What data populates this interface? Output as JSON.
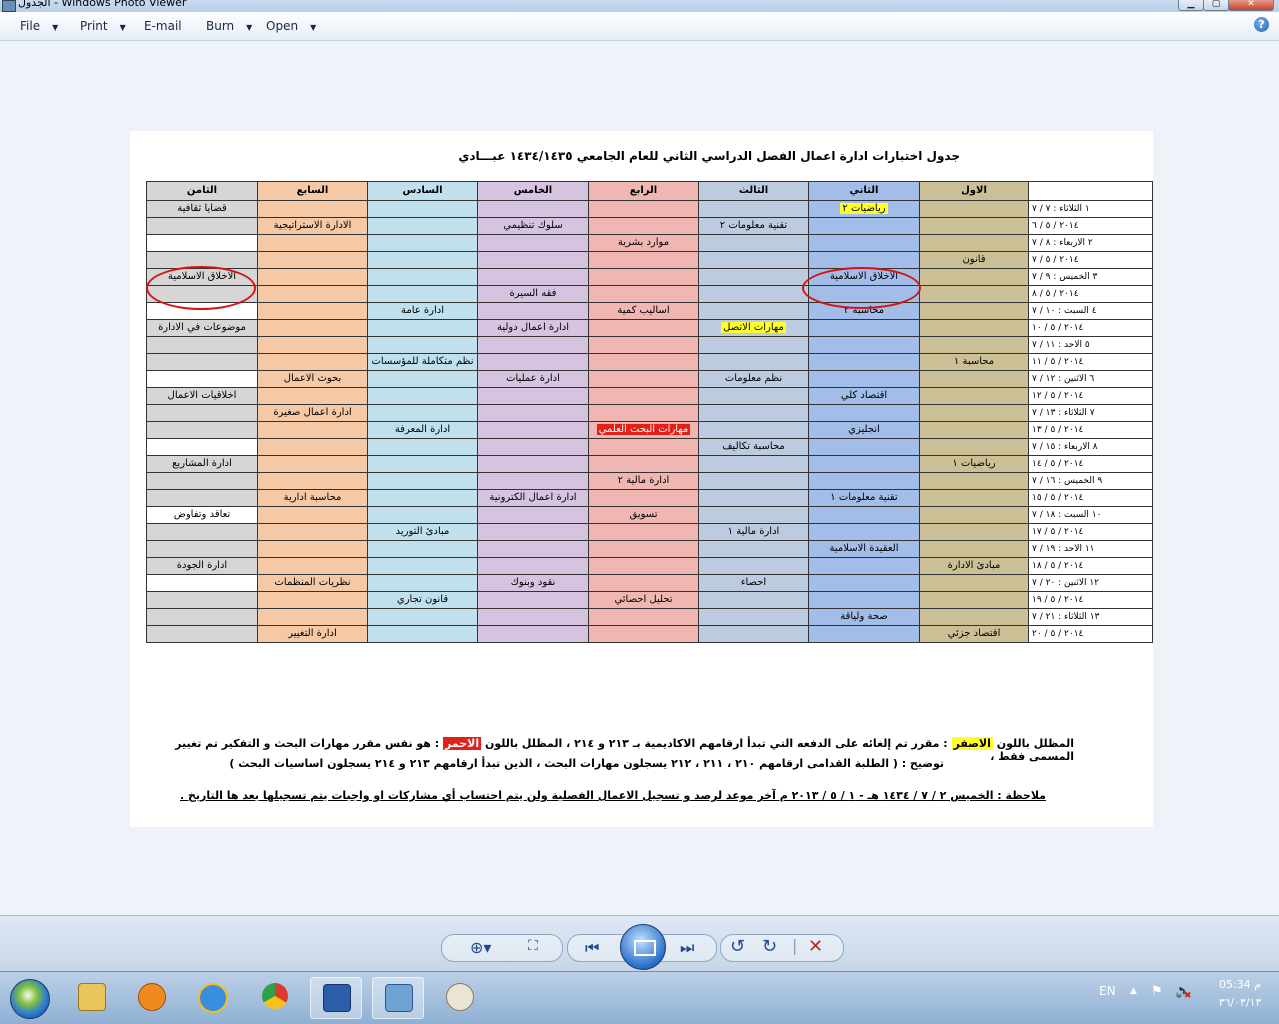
{
  "window": {
    "title": "الجدول - Windows Photo Viewer"
  },
  "menu": {
    "file": "File",
    "print": "Print",
    "email": "E-mail",
    "burn": "Burn",
    "open": "Open",
    "help": "?"
  },
  "doc": {
    "title": "جدول اختبارات ادارة اعمال الفصل الدراسي الثاني للعام الجامعي ١٤٣٤/١٤٣٥ عبـــادي",
    "headers": [
      "الثامن",
      "السابع",
      "السادس",
      "الخامس",
      "الرابع",
      "الثالث",
      "الثاني",
      "الاول",
      ""
    ],
    "rows": [
      {
        "day1": "١ الثلاثاء : ٧ / ٧",
        "day2": "٢٠١٤ / ٥ / ٦",
        "a": [
          "قضايا ثقافية",
          "",
          "",
          "",
          "",
          "",
          "رياضيات ٢",
          ""
        ],
        "b": [
          "",
          "الادارة الاستراتيجية",
          "",
          "سلوك تنظيمي",
          "",
          "تقنية معلومات ٢",
          "",
          ""
        ]
      },
      {
        "day1": "٢ الاربعاء : ٨ / ٧",
        "day2": "٢٠١٤ / ٥ / ٧",
        "a": [
          "",
          "",
          "",
          "",
          "موارد بشرية",
          "",
          "",
          ""
        ],
        "b": [
          "",
          "",
          "",
          "",
          "",
          "",
          "",
          "قانون"
        ]
      },
      {
        "day1": "٣ الخميس : ٩ / ٧",
        "day2": "٢٠١٤ / ٥ / ٨",
        "a": [
          "الاخلاق الاسلامية",
          "",
          "",
          "",
          "",
          "",
          "الاخلاق الاسلامية",
          ""
        ],
        "b": [
          "",
          "",
          "",
          "فقه السيرة",
          "",
          "",
          "",
          ""
        ]
      },
      {
        "day1": "٤ السبت : ١٠ / ٧",
        "day2": "٢٠١٤ / ٥ / ١٠",
        "a": [
          "",
          "",
          "ادارة عامة",
          "",
          "اساليب كمية",
          "",
          "محاسبة ٢",
          ""
        ],
        "b": [
          "موضوعات في الادارة",
          "",
          "",
          "ادارة اعمال دولية",
          "",
          "مهارات الاتصل",
          "",
          ""
        ]
      },
      {
        "day1": "٥ الاحد : ١١ / ٧",
        "day2": "٢٠١٤ / ٥ / ١١",
        "a": [
          "",
          "",
          "",
          "",
          "",
          "",
          "",
          ""
        ],
        "b": [
          "",
          "",
          "نظم متكاملة للمؤسسات",
          "",
          "",
          "",
          "",
          "محاسبة ١"
        ]
      },
      {
        "day1": "٦ الاثنين : ١٢ / ٧",
        "day2": "٢٠١٤ / ٥ / ١٢",
        "a": [
          "",
          "بحوث الاعمال",
          "",
          "ادارة عمليات",
          "",
          "نظم معلومات",
          "",
          ""
        ],
        "b": [
          "اخلاقيات الاعمال",
          "",
          "",
          "",
          "",
          "",
          "اقتصاد كلي",
          ""
        ]
      },
      {
        "day1": "٧ الثلاثاء : ١٣ / ٧",
        "day2": "٢٠١٤ / ٥ / ١٣",
        "a": [
          "",
          "ادارة اعمال صغيرة",
          "",
          "",
          "",
          "",
          "",
          ""
        ],
        "b": [
          "",
          "",
          "ادارة المعرفة",
          "",
          "مهارات البحث العلمي",
          "",
          "انجليزي",
          ""
        ]
      },
      {
        "day1": "٨ الاربعاء : ١٥ / ٧",
        "day2": "٢٠١٤ / ٥ / ١٤",
        "a": [
          "",
          "",
          "",
          "",
          "",
          "محاسبة تكاليف",
          "",
          ""
        ],
        "b": [
          "ادارة المشاريع",
          "",
          "",
          "",
          "",
          "",
          "",
          "رياضيات ١"
        ]
      },
      {
        "day1": "٩ الخميس : ١٦ / ٧",
        "day2": "٢٠١٤ / ٥ / ١٥",
        "a": [
          "",
          "",
          "",
          "",
          "ادارة مالية ٢",
          "",
          "",
          ""
        ],
        "b": [
          "",
          "محاسبة ادارية",
          "",
          "ادارة اعمال الكترونية",
          "",
          "",
          "تقنية معلومات ١",
          ""
        ]
      },
      {
        "day1": "١٠ السبت : ١٨ / ٧",
        "day2": "٢٠١٤ / ٥ / ١٧",
        "a": [
          "تعاقد وتفاوض",
          "",
          "",
          "",
          "تسويق",
          "",
          "",
          ""
        ],
        "b": [
          "",
          "",
          "مبادئ التوريد",
          "",
          "",
          "ادارة مالية ١",
          "",
          ""
        ]
      },
      {
        "day1": "١١ الاحد : ١٩ / ٧",
        "day2": "٢٠١٤ / ٥ / ١٨",
        "a": [
          "",
          "",
          "",
          "",
          "",
          "",
          "العقيدة الاسلامية",
          ""
        ],
        "b": [
          "ادارة الجودة",
          "",
          "",
          "",
          "",
          "",
          "",
          "مبادئ الادارة"
        ]
      },
      {
        "day1": "١٢ الاثنين : ٢٠ / ٧",
        "day2": "٢٠١٤ / ٥ / ١٩",
        "a": [
          "",
          "نظريات المنظمات",
          "",
          "نقود وبنوك",
          "",
          "احصاء",
          "",
          ""
        ],
        "b": [
          "",
          "",
          "قانون تجاري",
          "",
          "تحليل احصائي",
          "",
          "",
          ""
        ]
      },
      {
        "day1": "١٣ الثلاثاء : ٢١ / ٧",
        "day2": "٢٠١٤ / ٥ / ٢٠",
        "a": [
          "",
          "",
          "",
          "",
          "",
          "",
          "صحة ولياقة",
          ""
        ],
        "b": [
          "",
          "ادارة التغيير",
          "",
          "",
          "",
          "",
          "",
          "اقتصاد جزئي"
        ]
      }
    ],
    "note1": {
      "p1": "المظلل باللون ",
      "yellow": "الاصفر",
      "p2": " : مقرر تم إلغائه على الدفعه التي تبدأ ارقامهم الاكاديمية بـ ٢١٣ و ٢١٤ ، المظلل باللون ",
      "red": "الاحمر",
      "p3": " : هو نفس مقرر مهارات البحث و التفكير تم تغيير المسمى فقط ،"
    },
    "note2": "توضيح : ( الطلبة القدامى ارقامهم ٢١٠ ، ٢١١ ، ٢١٢ يسجلون مهارات البحث ، الذين تبدأ ارقامهم ٢١٣ و ٢١٤ يسجلون اساسيات البحث )",
    "note3": "ملاحظة : الخميس ٢ / ٧ / ١٤٣٤ هـ - ١ / ٥ / ٢٠١٣ م آخر موعد لرصد و تسجيل الاعمال الفصلية ولن يتم احتساب أي مشاركات او واجبات يتم تسجيلها بعد ها التاريخ ."
  },
  "tray": {
    "lang": "EN",
    "time": "05:34 م",
    "date": "٣٦/٠٣/١٣"
  }
}
